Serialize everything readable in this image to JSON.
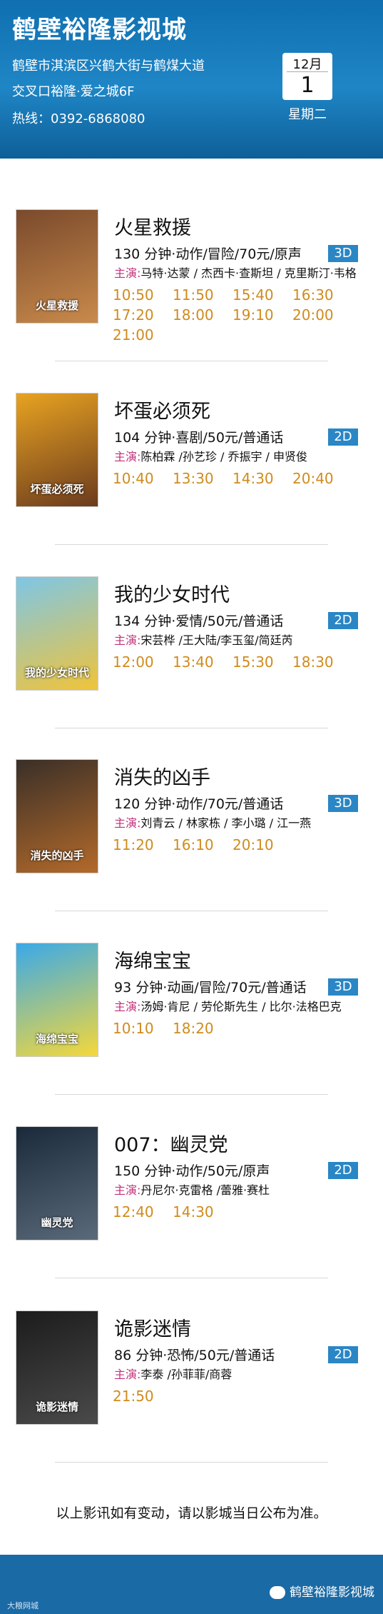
{
  "header": {
    "cinema_name": "鹤壁裕隆影视城",
    "address_line1": "鹤壁市淇滨区兴鹤大街与鹤煤大道",
    "address_line2": "交叉口裕隆·爱之城6F",
    "hotline": "热线：0392-6868080",
    "calendar": {
      "month": "12月",
      "day": "1",
      "weekday": "星期二"
    }
  },
  "movies": [
    {
      "title": "火星救援",
      "info": "130 分钟·动作/冒险/70元/原声",
      "format": "3D",
      "cast_label": "主演:",
      "cast": "马特·达蒙 / 杰西卡·查斯坦 / 克里斯汀·韦格",
      "times": [
        "10:50",
        "11:50",
        "15:40",
        "16:30",
        "17:20",
        "18:00",
        "19:10",
        "20:00",
        "21:00"
      ],
      "poster_colors": [
        "#7a4a2c",
        "#c98a4b"
      ],
      "poster_text": "火星救援"
    },
    {
      "title": "坏蛋必须死",
      "info": "104 分钟·喜剧/50元/普通话",
      "format": "2D",
      "cast_label": "主演:",
      "cast": "陈柏霖 /孙艺珍 / 乔振宇 / 申贤俊",
      "times": [
        "10:40",
        "13:30",
        "14:30",
        "20:40"
      ],
      "poster_colors": [
        "#e8a321",
        "#6b3b1e"
      ],
      "poster_text": "坏蛋必须死"
    },
    {
      "title": "我的少女时代",
      "info": "134 分钟·爱情/50元/普通话",
      "format": "2D",
      "cast_label": "主演:",
      "cast": "宋芸桦 /王大陆/李玉玺/简廷芮",
      "times": [
        "12:00",
        "13:40",
        "15:30",
        "18:30"
      ],
      "poster_colors": [
        "#7ec6e6",
        "#f0c43a"
      ],
      "poster_text": "我的少女时代"
    },
    {
      "title": "消失的凶手",
      "info": "120 分钟·动作/70元/普通话",
      "format": "3D",
      "cast_label": "主演:",
      "cast": "刘青云 / 林家栋 / 李小璐 / 江一燕",
      "times": [
        "11:20",
        "16:10",
        "20:10"
      ],
      "poster_colors": [
        "#3a2f28",
        "#b36a2a"
      ],
      "poster_text": "消失的凶手"
    },
    {
      "title": "海绵宝宝",
      "info": "93 分钟·动画/冒险/70元/普通话",
      "format": "3D",
      "cast_label": "主演:",
      "cast": "汤姆·肯尼 / 劳伦斯先生 / 比尔·法格巴克",
      "times": [
        "10:10",
        "18:20"
      ],
      "poster_colors": [
        "#3aa9e8",
        "#f5d83a"
      ],
      "poster_text": "海绵宝宝"
    },
    {
      "title": "007：幽灵党",
      "info": "150 分钟·动作/50元/原声",
      "format": "2D",
      "cast_label": "主演:",
      "cast": "丹尼尔·克雷格 /蕾雅·赛杜",
      "times": [
        "12:40",
        "14:30"
      ],
      "poster_colors": [
        "#1a2a3a",
        "#5a6a7a"
      ],
      "poster_text": "幽灵党"
    },
    {
      "title": "诡影迷情",
      "info": "86 分钟·恐怖/50元/普通话",
      "format": "2D",
      "cast_label": "主演:",
      "cast": "李泰 /孙菲菲/商蓉",
      "times": [
        "21:50"
      ],
      "poster_colors": [
        "#1c1c1c",
        "#4a4a4a"
      ],
      "poster_text": "诡影迷情"
    }
  ],
  "notice": "以上影讯如有变动，请以影城当日公布为准。",
  "footer": {
    "wechat_name": "鹤壁裕隆影视城",
    "watermark": "大粮网城"
  },
  "colors": {
    "header_blue": "#1877bb",
    "time_orange": "#d08b1d",
    "badge_blue": "#2a86c5",
    "cast_label": "#c0307a"
  }
}
